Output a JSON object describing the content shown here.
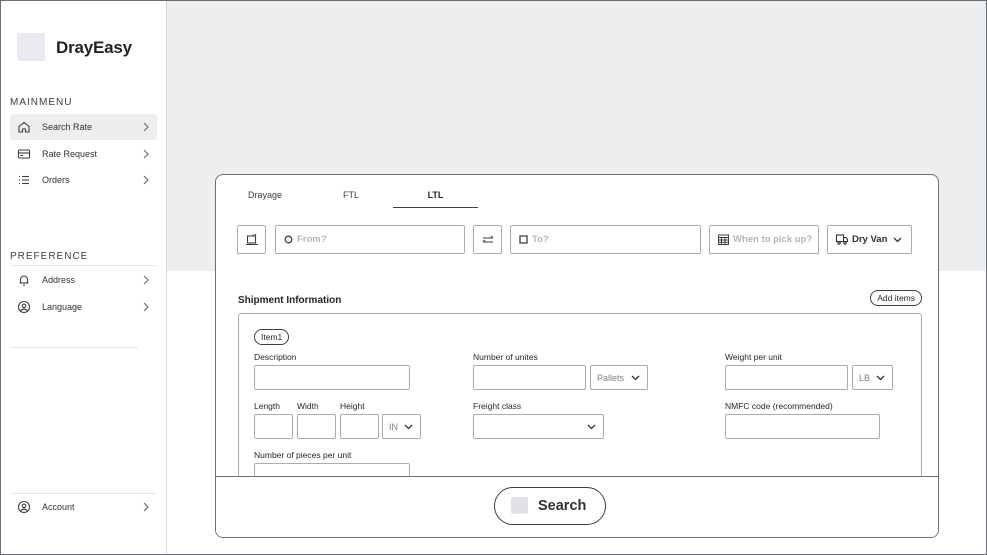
{
  "brand": {
    "name": "DrayEasy"
  },
  "sidebar": {
    "main_menu_label": "MAINMENU",
    "main_items": [
      {
        "label": "Search Rate",
        "icon": "home-icon",
        "active": true
      },
      {
        "label": "Rate Request",
        "icon": "card-icon",
        "active": false
      },
      {
        "label": "Orders",
        "icon": "list-icon",
        "active": false
      }
    ],
    "preference_label": "PREFERENCE",
    "preference_items": [
      {
        "label": "Address",
        "icon": "bell-icon"
      },
      {
        "label": "Language",
        "icon": "user-circle-icon"
      }
    ],
    "account": {
      "label": "Account",
      "icon": "user-circle-icon"
    }
  },
  "tabs": [
    {
      "label": "Drayage",
      "active": false
    },
    {
      "label": "FTL",
      "active": false
    },
    {
      "label": "LTL",
      "active": true
    }
  ],
  "search_bar": {
    "from_placeholder": "From?",
    "to_placeholder": "To?",
    "pickup_placeholder": "When to pick up?",
    "equipment": "Dry Van"
  },
  "shipment": {
    "title": "Shipment Information",
    "add_items_label": "Add items",
    "item_label": "Item1",
    "description_label": "Description",
    "units_label": "Number of unites",
    "units_type": "Pallets",
    "weight_label": "Weight per unit",
    "weight_unit": "LB",
    "length_label": "Length",
    "width_label": "Width",
    "height_label": "Height",
    "dim_unit": "IN",
    "freight_class_label": "Freight class",
    "nmfc_label": "NMFC code (recommended)",
    "pieces_label": "Number of pieces per unit"
  },
  "search_button": {
    "label": "Search"
  },
  "colors": {
    "accent_bg": "#eceef0",
    "border": "#6b6f75"
  }
}
